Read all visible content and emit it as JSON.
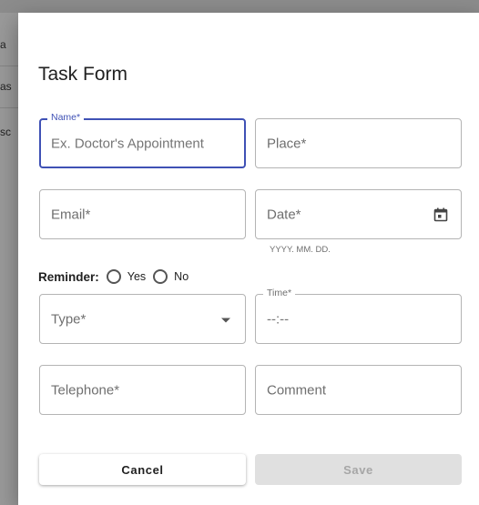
{
  "background_peek": [
    "a",
    "as",
    "sc"
  ],
  "dialog": {
    "title": "Task Form",
    "fields": {
      "name": {
        "label": "Name*",
        "placeholder": "Ex. Doctor's Appointment"
      },
      "place": {
        "label": "Place*"
      },
      "email": {
        "label": "Email*"
      },
      "date": {
        "label": "Date*",
        "helper": "YYYY. MM. DD.",
        "icon": "calendar-icon"
      },
      "type": {
        "label": "Type*",
        "icon": "dropdown-arrow-icon"
      },
      "time": {
        "label": "Time*",
        "value": "--:--"
      },
      "telephone": {
        "label": "Telephone*"
      },
      "comment": {
        "label": "Comment"
      }
    },
    "reminder": {
      "label": "Reminder:",
      "options": [
        "Yes",
        "No"
      ]
    },
    "buttons": {
      "cancel": "Cancel",
      "save": "Save"
    }
  },
  "colors": {
    "accent": "#3f51b5",
    "border": "#b4b4b4",
    "disabled_button": "#e0e0e0"
  }
}
